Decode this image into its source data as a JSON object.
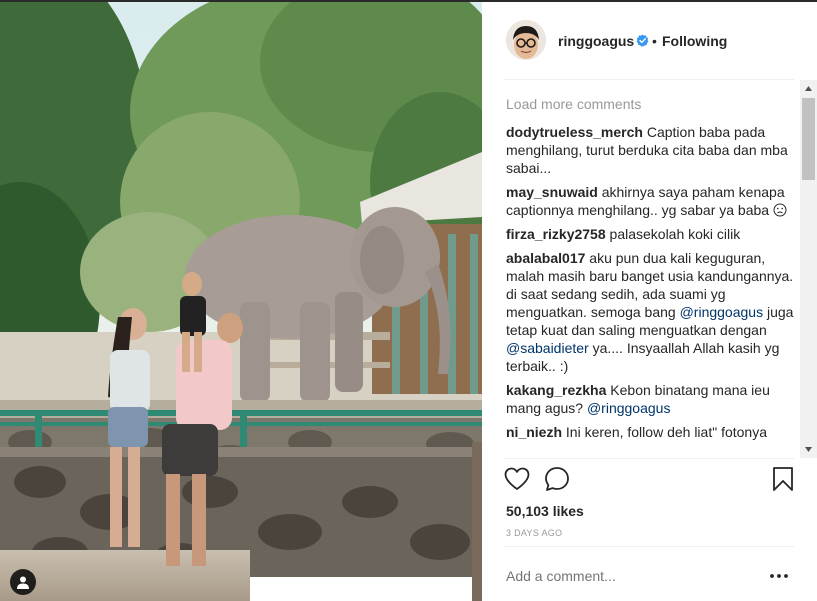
{
  "post": {
    "author": "ringgoagus",
    "separator": "•",
    "follow_status": "Following",
    "load_more": "Load more comments",
    "likes": "50,103 likes",
    "timestamp": "3 DAYS AGO",
    "comment_placeholder": "Add a comment..."
  },
  "comments": [
    {
      "user": "dodytrueless_merch",
      "parts": [
        {
          "t": "Caption baba pada menghilang, turut berduka cita baba dan mba sabai..."
        }
      ]
    },
    {
      "user": "may_snuwaid",
      "parts": [
        {
          "t": "akhirnya saya paham kenapa captionnya menghilang.. yg sabar ya baba "
        }
      ],
      "emoji": "sad-face"
    },
    {
      "user": "firza_rizky2758",
      "parts": [
        {
          "t": "palasekolah koki cilik"
        }
      ]
    },
    {
      "user": "abalabal017",
      "parts": [
        {
          "t": "aku pun dua kali keguguran, malah masih baru banget usia kandungannya. di saat sedang sedih, ada suami yg menguatkan. semoga bang "
        },
        {
          "t": "@ringgoagus",
          "m": true
        },
        {
          "t": " juga tetap kuat dan saling menguatkan dengan "
        },
        {
          "t": "@sabaidieter",
          "m": true
        },
        {
          "t": " ya.... Insyaallah Allah kasih yg terbaik.. :)"
        }
      ]
    },
    {
      "user": "kakang_rezkha",
      "parts": [
        {
          "t": "Kebon binatang mana ieu mang agus? "
        },
        {
          "t": "@ringgoagus",
          "m": true
        }
      ]
    },
    {
      "user": "ni_niezh",
      "parts": [
        {
          "t": "Ini keren, follow deh liat\" fotonya"
        }
      ]
    }
  ],
  "icons": {
    "verified": "verified-badge-icon",
    "like": "heart-icon",
    "comment": "comment-bubble-icon",
    "save": "bookmark-icon",
    "more": "more-options-icon",
    "tag": "user-tag-icon"
  },
  "colors": {
    "link": "#003569",
    "verified": "#3897f0",
    "muted": "#999999"
  }
}
